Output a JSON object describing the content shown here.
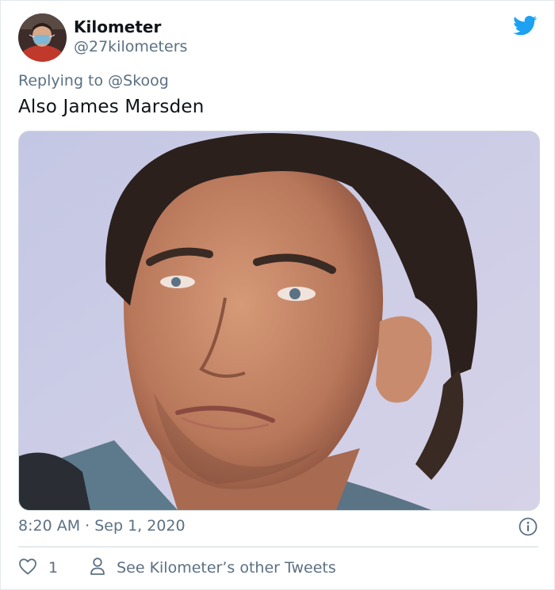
{
  "user": {
    "display_name": "Kilometer",
    "handle": "@27kilometers"
  },
  "reply": {
    "prefix": "Replying to ",
    "mention": "@Skoog"
  },
  "tweet": {
    "text": "Also James Marsden",
    "timestamp": "8:20 AM · Sep 1, 2020"
  },
  "actions": {
    "like_count": "1",
    "other_tweets_label": "See Kilometer’s other Tweets"
  },
  "icons": {
    "brand": "twitter-bird-icon",
    "info": "info-icon",
    "like": "heart-icon",
    "profile": "person-icon"
  },
  "colors": {
    "twitter_blue": "#1da1f2",
    "secondary_text": "#5b7083",
    "primary_text": "#0f1419",
    "divider": "#cfd9de"
  }
}
